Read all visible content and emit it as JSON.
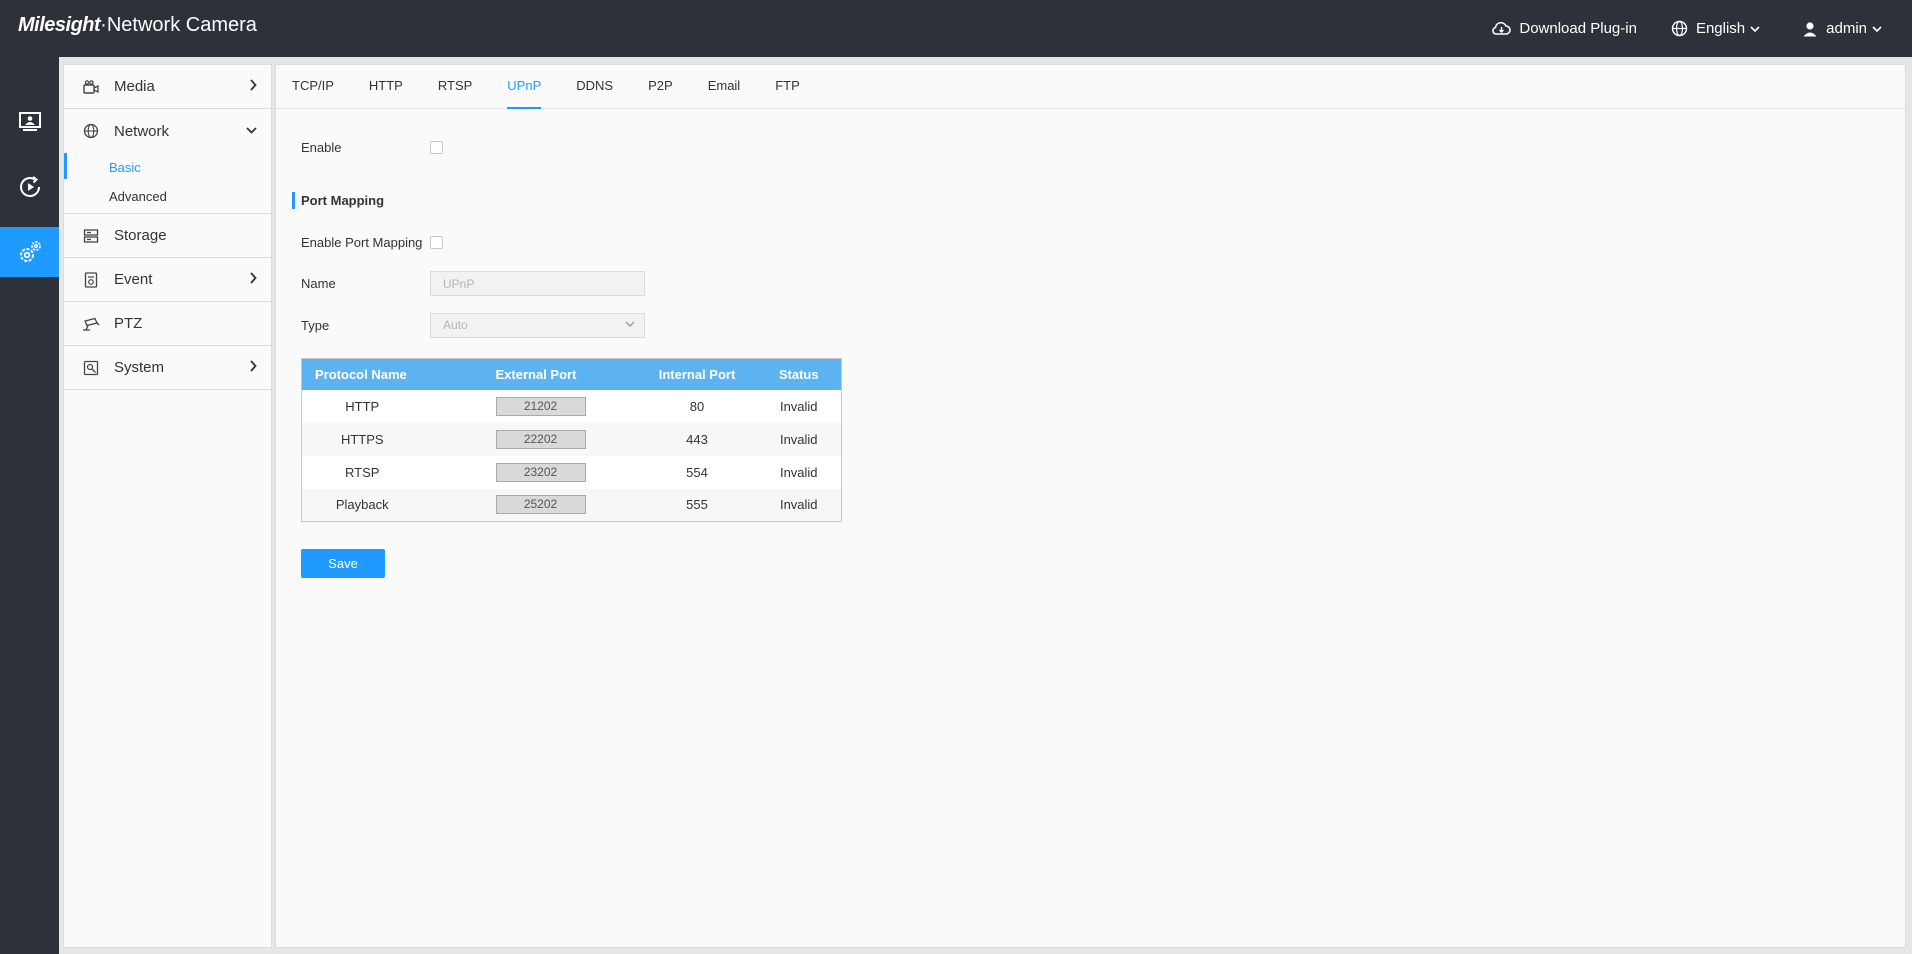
{
  "header": {
    "brand_logo": "Milesight",
    "brand_title": "Network Camera",
    "download_label": "Download Plug-in",
    "language_label": "English",
    "user_label": "admin"
  },
  "rail": {
    "items": [
      {
        "icon": "live-view-icon"
      },
      {
        "icon": "playback-icon"
      },
      {
        "icon": "settings-icon",
        "active": true
      }
    ]
  },
  "sidebar": {
    "items": [
      {
        "label": "Media",
        "icon": "camera-icon"
      },
      {
        "label": "Network",
        "icon": "globe-icon",
        "open": true,
        "children": [
          {
            "label": "Basic",
            "active": true
          },
          {
            "label": "Advanced"
          }
        ]
      },
      {
        "label": "Storage",
        "icon": "storage-icon"
      },
      {
        "label": "Event",
        "icon": "event-icon"
      },
      {
        "label": "PTZ",
        "icon": "ptz-icon"
      },
      {
        "label": "System",
        "icon": "system-icon"
      }
    ]
  },
  "tabs": [
    {
      "label": "TCP/IP"
    },
    {
      "label": "HTTP"
    },
    {
      "label": "RTSP"
    },
    {
      "label": "UPnP",
      "active": true
    },
    {
      "label": "DDNS"
    },
    {
      "label": "P2P"
    },
    {
      "label": "Email"
    },
    {
      "label": "FTP"
    }
  ],
  "form": {
    "enable_label": "Enable",
    "enable_checked": false,
    "section_title": "Port Mapping",
    "enable_port_mapping_label": "Enable Port Mapping",
    "enable_port_mapping_checked": false,
    "name_label": "Name",
    "name_value": "UPnP",
    "type_label": "Type",
    "type_value": "Auto"
  },
  "table": {
    "headers": [
      "Protocol Name",
      "External Port",
      "Internal Port",
      "Status"
    ],
    "rows": [
      {
        "protocol": "HTTP",
        "external": "21202",
        "internal": "80",
        "status": "Invalid"
      },
      {
        "protocol": "HTTPS",
        "external": "22202",
        "internal": "443",
        "status": "Invalid"
      },
      {
        "protocol": "RTSP",
        "external": "23202",
        "internal": "554",
        "status": "Invalid"
      },
      {
        "protocol": "Playback",
        "external": "25202",
        "internal": "555",
        "status": "Invalid"
      }
    ]
  },
  "actions": {
    "save_label": "Save"
  },
  "colors": {
    "accent": "#1f9bff",
    "topbar": "#2c313a",
    "table_header": "#5db3ef"
  }
}
